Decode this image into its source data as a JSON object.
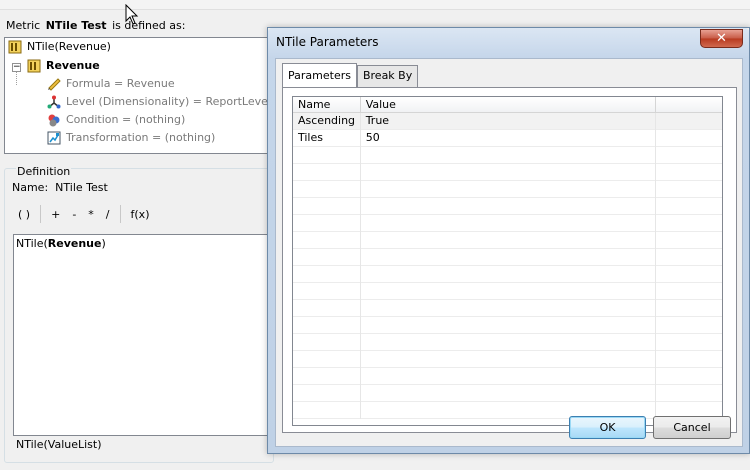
{
  "metric": {
    "prefix": "Metric",
    "name": "NTile Test",
    "suffix": "is defined as:"
  },
  "tree": {
    "root": "NTile(Revenue)",
    "child": "Revenue",
    "items": [
      "Formula = Revenue",
      "Level (Dimensionality) = ReportLevel",
      "Condition = (nothing)",
      "Transformation = (nothing)"
    ]
  },
  "definition": {
    "legend": "Definition",
    "name_label": "Name:",
    "name_value": "NTile Test",
    "toolbar": [
      "( )",
      "+",
      "-",
      "*",
      "/",
      "f(x)"
    ],
    "expression_func": "NTile(",
    "expression_arg": "Revenue",
    "expression_close": ")",
    "status": "NTile(ValueList)"
  },
  "dialog": {
    "title": "NTile Parameters",
    "close_label": "✕",
    "tabs": [
      "Parameters",
      "Break By"
    ],
    "columns": [
      "Name",
      "Value"
    ],
    "rows": [
      {
        "name": "Ascending",
        "value": "True"
      },
      {
        "name": "Tiles",
        "value": "50"
      }
    ],
    "ok_label": "OK",
    "cancel_label": "Cancel"
  }
}
